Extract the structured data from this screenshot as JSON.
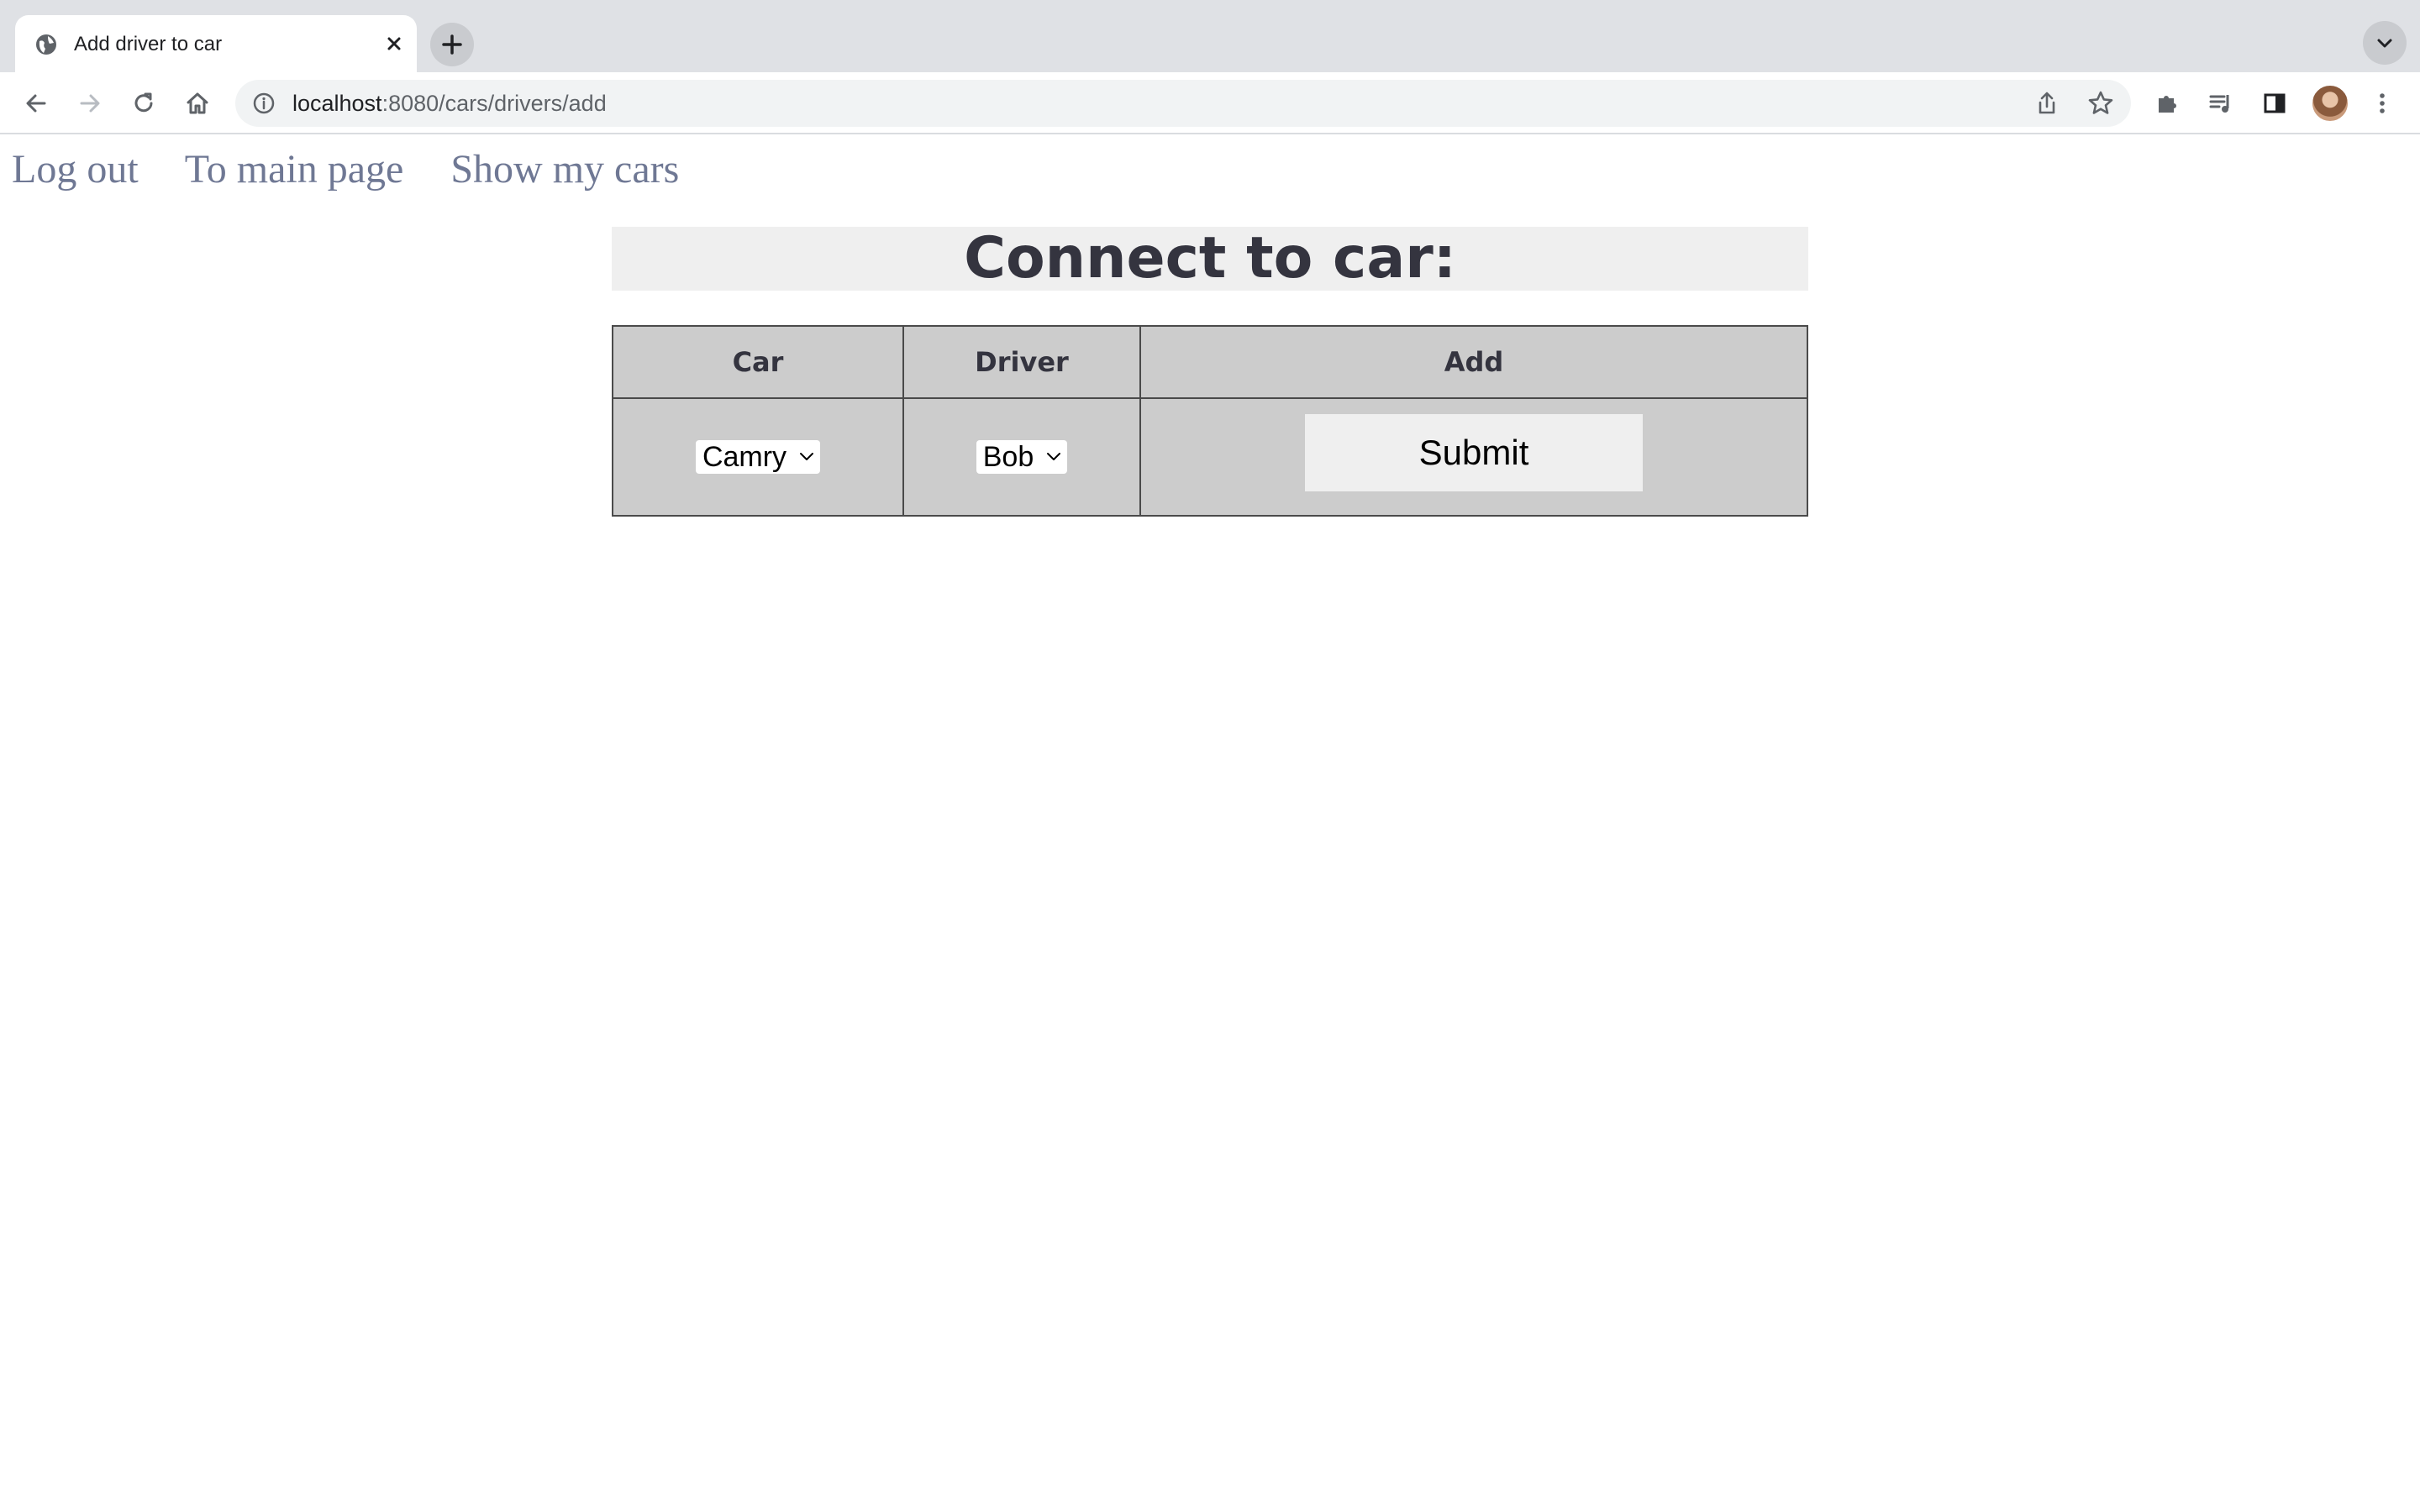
{
  "browser": {
    "tab_title": "Add driver to car",
    "url_host": "localhost",
    "url_rest": ":8080/cars/drivers/add"
  },
  "nav": {
    "logout": "Log out",
    "main_page": "To main page",
    "my_cars": "Show my cars"
  },
  "page": {
    "title": "Connect to car:"
  },
  "table": {
    "headers": [
      "Car",
      "Driver",
      "Add"
    ],
    "car_selected": "Camry",
    "driver_selected": "Bob",
    "submit_label": "Submit"
  }
}
